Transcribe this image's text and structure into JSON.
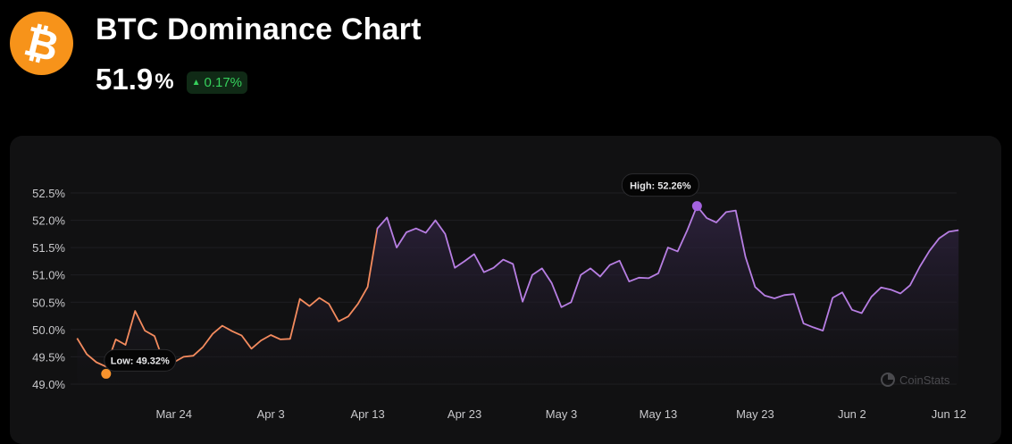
{
  "header": {
    "logo_symbol": "₿",
    "logo_color": "#f7931a",
    "title": "BTC Dominance Chart",
    "value": "51.9",
    "unit": "%",
    "change": "0.17%",
    "change_color": "#36d15c"
  },
  "chart_data": {
    "type": "area",
    "title": "",
    "xlabel": "",
    "ylabel": "",
    "ylim": [
      49.0,
      52.5
    ],
    "yticks": [
      "52.5%",
      "52.0%",
      "51.5%",
      "51.0%",
      "50.5%",
      "50.0%",
      "49.5%",
      "49.0%"
    ],
    "ytick_values": [
      52.5,
      52.0,
      51.5,
      51.0,
      50.5,
      50.0,
      49.5,
      49.0
    ],
    "xticks": [
      "Mar 24",
      "Apr 3",
      "Apr 13",
      "Apr 23",
      "May 3",
      "May 13",
      "May 23",
      "Jun 2",
      "Jun 12"
    ],
    "xtick_days": [
      10,
      20,
      30,
      40,
      50,
      60,
      70,
      80,
      90
    ],
    "x_days_range": [
      -0.3,
      90.8
    ],
    "grid": true,
    "colors": {
      "low_segment": "#f48b5e",
      "high_segment": "#b77ee3",
      "low_marker": "#f7932d",
      "high_marker": "#a463e0"
    },
    "series": [
      {
        "values": [
          49.84,
          49.55,
          49.4,
          49.32,
          49.82,
          49.72,
          50.34,
          49.98,
          49.88,
          49.38,
          49.4,
          49.5,
          49.52,
          49.68,
          49.92,
          50.07,
          49.97,
          49.89,
          49.65,
          49.8,
          49.9,
          49.82,
          49.83,
          50.56,
          50.43,
          50.58,
          50.47,
          50.15,
          50.24,
          50.47,
          50.78,
          51.85,
          52.05,
          51.5,
          51.78,
          51.85,
          51.77,
          52.0,
          51.75,
          51.13,
          51.25,
          51.38,
          51.05,
          51.13,
          51.28,
          51.2,
          50.51,
          51.0,
          51.12,
          50.85,
          50.41,
          50.5,
          51.0,
          51.12,
          50.97,
          51.18,
          51.26,
          50.88,
          50.95,
          50.94,
          51.03,
          51.5,
          51.43,
          51.82,
          52.26,
          52.04,
          51.96,
          52.15,
          52.18,
          51.33,
          50.78,
          50.62,
          50.57,
          50.63,
          50.65,
          50.11,
          50.04,
          49.98,
          50.58,
          50.68,
          50.36,
          50.3,
          50.6,
          50.77,
          50.73,
          50.66,
          50.81,
          51.15,
          51.44,
          51.67,
          51.79,
          51.82
        ]
      }
    ],
    "annotations": {
      "low": {
        "label": "Low: 49.32%",
        "index": 3,
        "value": 49.32
      },
      "high": {
        "label": "High: 52.26%",
        "index": 64,
        "value": 52.26
      }
    }
  },
  "watermark": {
    "text": "CoinStats",
    "icon": "coinstats-logo-icon"
  }
}
